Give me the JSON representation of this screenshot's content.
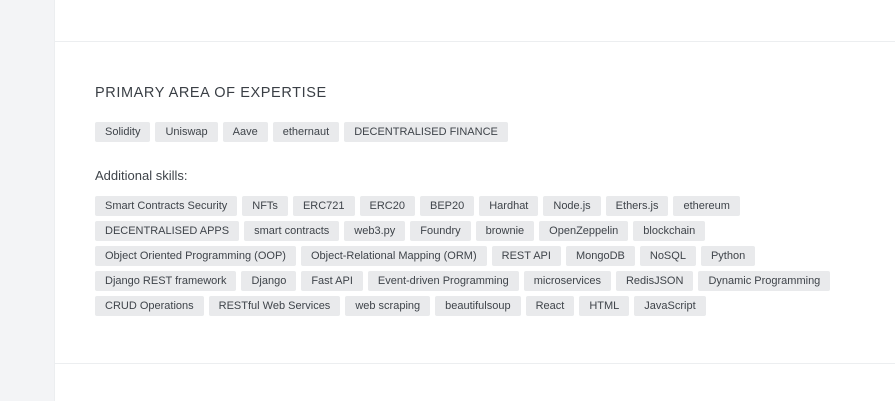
{
  "expertise": {
    "title": "PRIMARY AREA OF EXPERTISE",
    "tags": [
      "Solidity",
      "Uniswap",
      "Aave",
      "ethernaut",
      "DECENTRALISED FINANCE"
    ]
  },
  "additional": {
    "title": "Additional skills:",
    "tags": [
      "Smart Contracts Security",
      "NFTs",
      "ERC721",
      "ERC20",
      "BEP20",
      "Hardhat",
      "Node.js",
      "Ethers.js",
      "ethereum",
      "DECENTRALISED APPS",
      "smart contracts",
      "web3.py",
      "Foundry",
      "brownie",
      "OpenZeppelin",
      "blockchain",
      "Object Oriented Programming (OOP)",
      "Object-Relational Mapping (ORM)",
      "REST API",
      "MongoDB",
      "NoSQL",
      "Python",
      "Django REST framework",
      "Django",
      "Fast API",
      "Event-driven Programming",
      "microservices",
      "RedisJSON",
      "Dynamic Programming",
      "CRUD Operations",
      "RESTful Web Services",
      "web scraping",
      "beautifulsoup",
      "React",
      "HTML",
      "JavaScript"
    ]
  }
}
